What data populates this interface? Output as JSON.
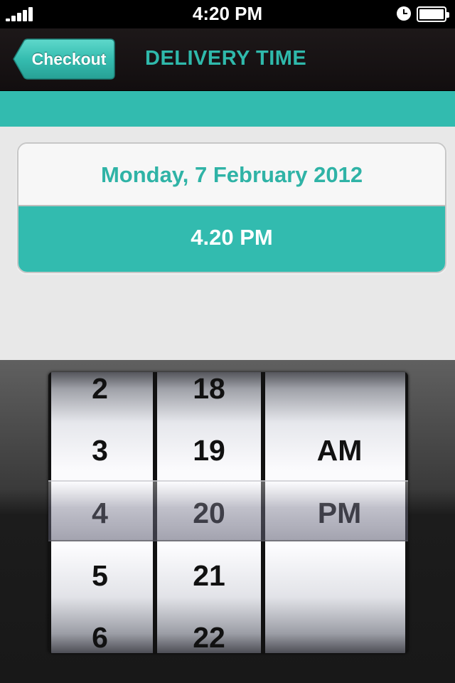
{
  "status_bar": {
    "time": "4:20 PM",
    "icons": [
      "signal-icon",
      "alarm-icon",
      "battery-icon"
    ]
  },
  "nav": {
    "back_label": "Checkout",
    "title": "DELIVERY TIME"
  },
  "card": {
    "date": "Monday, 7 February 2012",
    "time": "4.20 PM"
  },
  "picker": {
    "hours": [
      "2",
      "3",
      "4",
      "5",
      "6"
    ],
    "minutes": [
      "18",
      "19",
      "20",
      "21",
      "22"
    ],
    "ampm": [
      "AM",
      "PM"
    ],
    "selected": {
      "hour": "4",
      "minute": "20",
      "ampm": "PM"
    }
  },
  "colors": {
    "accent": "#32bbaf",
    "title_teal": "#2fb9ab",
    "nav_background": "#1a1516",
    "content_background": "#e8e8e8"
  }
}
